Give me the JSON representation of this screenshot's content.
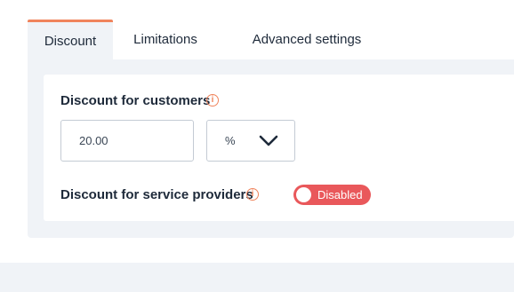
{
  "tabs": [
    {
      "label": "Discount",
      "active": true
    },
    {
      "label": "Limitations",
      "active": false
    },
    {
      "label": "Advanced settings",
      "active": false
    }
  ],
  "discount_customers": {
    "label": "Discount for customers",
    "info_icon": "info-icon",
    "value": "20.00",
    "unit_selected": "%"
  },
  "discount_providers": {
    "label": "Discount for service providers",
    "info_icon": "info-icon",
    "toggle_state_label": "Disabled",
    "enabled": false
  },
  "colors": {
    "accent": "#f0845c",
    "toggle_disabled": "#e9585b",
    "panel_bg": "#f0f3f7"
  }
}
